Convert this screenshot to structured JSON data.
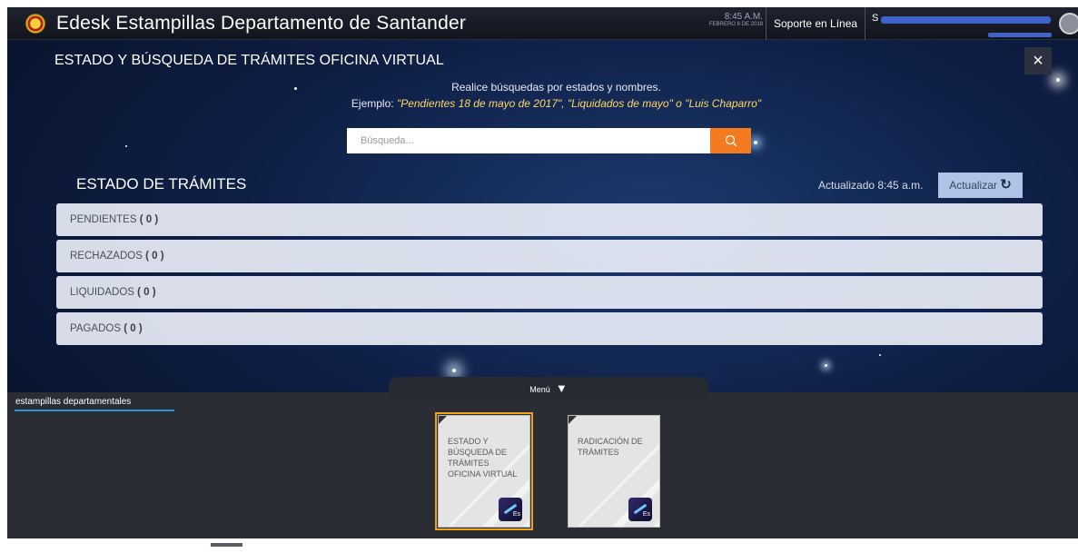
{
  "header": {
    "app_title": "Edesk Estampillas Departamento de Santander",
    "time": "8:45 A.M.",
    "date": "FEBRERO 6 DE 2018",
    "support_label": "Soporte en Línea",
    "user_initial": "S"
  },
  "panel": {
    "title": "ESTADO Y BÚSQUEDA DE TRÁMITES OFICINA VIRTUAL",
    "close_label": "×",
    "hint_line1": "Realice búsquedas por estados y nombres.",
    "hint_prefix": "Ejemplo: ",
    "hint_examples": "\"Pendientes 18 de mayo de 2017\", \"Liquidados de mayo\" o \"Luis Chaparro\"",
    "search_placeholder": "Búsqueda...",
    "section_title": "ESTADO DE TRÁMITES",
    "updated_text": "Actualizado 8:45 a.m.",
    "refresh_label": "Actualizar",
    "statuses": [
      {
        "label": "PENDIENTES",
        "count": "( 0 )"
      },
      {
        "label": "RECHAZADOS",
        "count": "( 0 )"
      },
      {
        "label": "LIQUIDADOS",
        "count": "( 0 )"
      },
      {
        "label": "PAGADOS",
        "count": "( 0 )"
      }
    ]
  },
  "menu": {
    "toggle_label": "Menú",
    "tab_label": "estampillas departamentales",
    "tiles": [
      {
        "label": "ESTADO Y BÚSQUEDA DE TRÁMITES OFICINA VIRTUAL",
        "icon_text": "Es",
        "selected": true
      },
      {
        "label": "RADICACIÓN DE TRÁMITES",
        "icon_text": "Es",
        "selected": false
      }
    ]
  },
  "colors": {
    "accent_orange": "#f47a20",
    "selection_border": "#f0a21b",
    "tab_underline": "#2e91d6"
  },
  "icons": [
    "app-logo-icon",
    "search-icon",
    "close-icon",
    "refresh-icon",
    "menu-arrow-down-icon",
    "app-es-icon",
    "avatar-icon"
  ]
}
